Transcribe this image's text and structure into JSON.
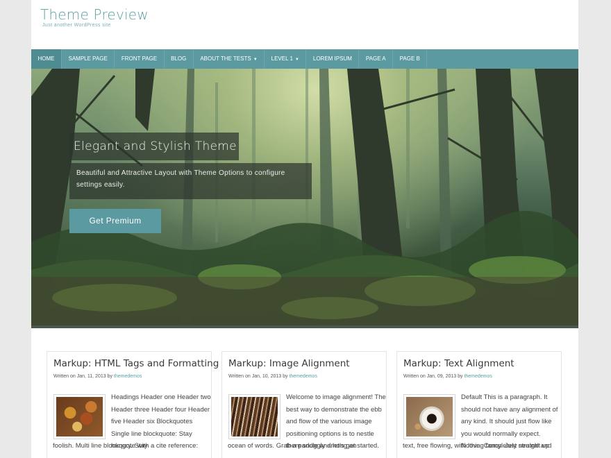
{
  "site": {
    "title": "Theme Preview",
    "description": "Just another WordPress site"
  },
  "nav": {
    "items": [
      {
        "label": "HOME",
        "active": true,
        "dropdown": false
      },
      {
        "label": "SAMPLE PAGE",
        "dropdown": false
      },
      {
        "label": "FRONT PAGE",
        "dropdown": false
      },
      {
        "label": "BLOG",
        "dropdown": false
      },
      {
        "label": "ABOUT THE TESTS",
        "dropdown": true
      },
      {
        "label": "LEVEL 1",
        "dropdown": true
      },
      {
        "label": "LOREM IPSUM",
        "dropdown": false
      },
      {
        "label": "PAGE A",
        "dropdown": false
      },
      {
        "label": "PAGE B",
        "dropdown": false
      }
    ]
  },
  "slider": {
    "title": "Elegant and Stylish Theme",
    "text": "Beautiful and Attractive Layout with Theme Options to configure settings easily.",
    "button": "Get Premium"
  },
  "posts": [
    {
      "title": "Markup: HTML Tags and Formatting",
      "meta_prefix": "Written on Jan, 11, 2013 by",
      "author": "themedemos",
      "thumb": "autumn-leaves-image",
      "excerpt_top": "Headings Header one Header two Header three Header four Header five Header six Blockquotes Single line blockquote: Stay hungry. Stay",
      "excerpt_bottom": "foolish. Multi line blockquote with a cite reference:"
    },
    {
      "title": "Markup: Image Alignment",
      "meta_prefix": "Written on Jan, 10, 2013 by",
      "author": "themedemos",
      "thumb": "paint-brushes-image",
      "excerpt_top": "Welcome to image alignment! The best way to demonstrate the ebb and flow of the various image positioning options is to nestle them snuggly among an",
      "excerpt_bottom": "ocean of words. Grab a paddle and let's get started."
    },
    {
      "title": "Markup: Text Alignment",
      "meta_prefix": "Written on Jan, 09, 2013 by",
      "author": "themedemos",
      "thumb": "coffee-cup-image",
      "excerpt_top": "Default This is a paragraph. It should not have any alignment of any kind. It should just flow like you would normally expect. Nothing fancy. Just straight up",
      "excerpt_bottom": "text, free flowing, with love. Completely neutral and"
    }
  ],
  "colors": {
    "accent": "#5b9aa0",
    "title": "#5a9fa3",
    "background": "#e9e9e9"
  }
}
